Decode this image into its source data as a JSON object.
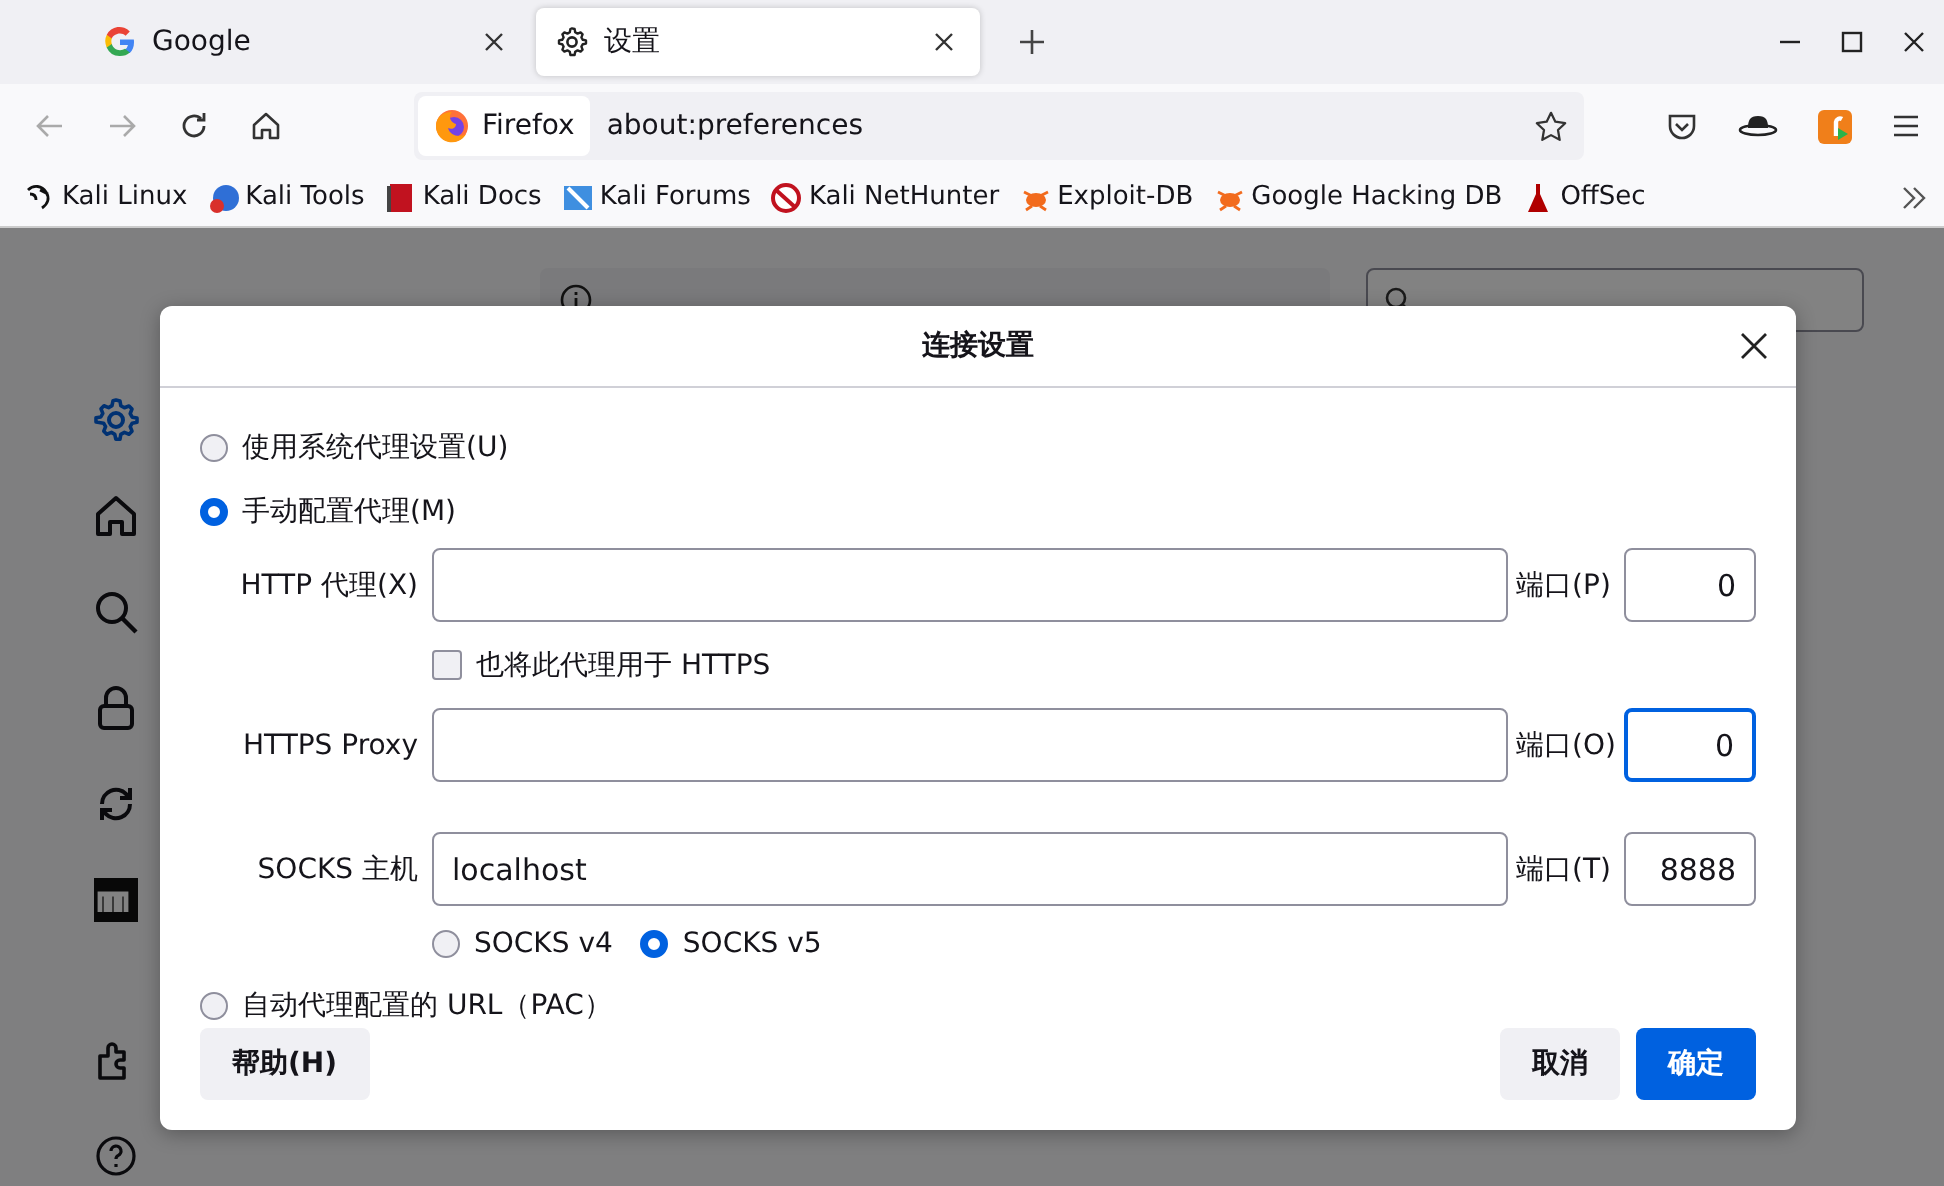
{
  "tabs": [
    {
      "label": "Google",
      "selected": false
    },
    {
      "label": "设置",
      "selected": true
    }
  ],
  "address_bar": {
    "identity": "Firefox",
    "url": "about:preferences"
  },
  "bookmarks": [
    "Kali Linux",
    "Kali Tools",
    "Kali Docs",
    "Kali Forums",
    "Kali NetHunter",
    "Exploit-DB",
    "Google Hacking DB",
    "OffSec"
  ],
  "preferences": {
    "sidebar": [
      {
        "selected": true
      },
      {
        "selected": false
      },
      {
        "selected": false
      },
      {
        "selected": false
      },
      {
        "selected": false
      },
      {
        "selected": false
      },
      {
        "selected": false
      },
      {
        "selected": false
      }
    ]
  },
  "dialog": {
    "title": "连接设置",
    "proxy_modes": [
      {
        "label": "使用系统代理设置(U)",
        "selected": false
      },
      {
        "label": "手动配置代理(M)",
        "selected": true
      },
      {
        "label": "自动代理配置的 URL（PAC）",
        "selected": false
      }
    ],
    "http": {
      "label": "HTTP 代理(X)",
      "port_label": "端口(P)",
      "port": "0",
      "focused": false
    },
    "also_https": {
      "label": "也将此代理用于 HTTPS",
      "checked": false
    },
    "https": {
      "label": "HTTPS Proxy",
      "port_label": "端口(O)",
      "port": "0",
      "focused": true
    },
    "socks": {
      "label": "SOCKS 主机",
      "value": "localhost",
      "port_label": "端口(T)",
      "port": "8888",
      "focused": false
    },
    "socks_versions": [
      {
        "label": "SOCKS v4",
        "selected": false
      },
      {
        "label": "SOCKS v5",
        "selected": true
      }
    ],
    "buttons": {
      "help": "帮助(H)",
      "cancel": "取消",
      "ok": "确定"
    }
  }
}
